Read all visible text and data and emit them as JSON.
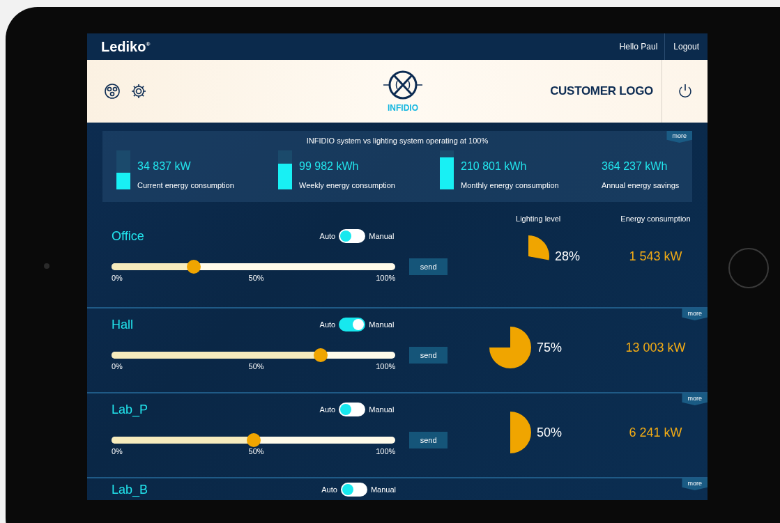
{
  "top_bar": {
    "brand": "Lediko",
    "brand_mark": "®",
    "greeting": "Hello Paul",
    "logout": "Logout"
  },
  "header": {
    "logo_text": "INFIDIO",
    "customer_logo": "CUSTOMER LOGO"
  },
  "summary": {
    "title": "INFIDIO system vs lighting system operating at 100%",
    "more": "more",
    "stats": [
      {
        "value": "34 837 kW",
        "label": "Current energy consumption",
        "level": 0.42
      },
      {
        "value": "99 982 kWh",
        "label": "Weekly energy consumption",
        "level": 0.66
      },
      {
        "value": "210 801 kWh",
        "label": "Monthly energy consumption",
        "level": 0.82
      },
      {
        "value": "364 237 kWh",
        "label": "Annual energy savings"
      }
    ]
  },
  "room_headers": {
    "lighting": "Lighting level",
    "energy": "Energy consumption"
  },
  "rooms": [
    {
      "name": "Office",
      "auto": "Auto",
      "manual_label": "Manual",
      "manual": false,
      "level": 0.28,
      "ticks": [
        "0%",
        "50%",
        "100%"
      ],
      "send": "send",
      "percent": "28%",
      "energy": "1 543 kW"
    },
    {
      "name": "Hall",
      "more": "more",
      "auto": "Auto",
      "manual_label": "Manual",
      "manual": true,
      "level": 0.75,
      "ticks": [
        "0%",
        "50%",
        "100%"
      ],
      "send": "send",
      "percent": "75%",
      "energy": "13 003 kW"
    },
    {
      "name": "Lab_P",
      "more": "more",
      "auto": "Auto",
      "manual_label": "Manual",
      "manual": false,
      "level": 0.5,
      "ticks": [
        "0%",
        "50%",
        "100%"
      ],
      "send": "send",
      "percent": "50%",
      "energy": "6 241 kW"
    },
    {
      "name": "Lab_B",
      "more": "more",
      "auto": "Auto",
      "manual_label": "Manual",
      "manual": false
    }
  ]
}
